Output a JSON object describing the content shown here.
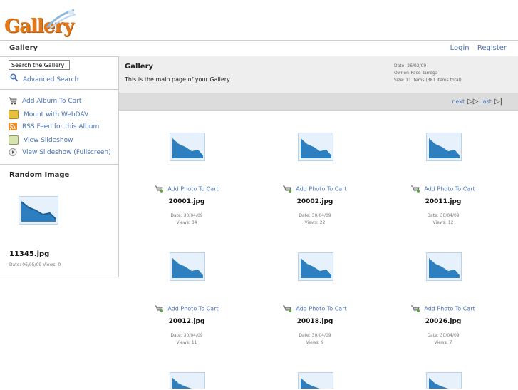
{
  "logo": {
    "text": "Gallery"
  },
  "topbar": {
    "title": "Gallery",
    "login": "Login",
    "register": "Register"
  },
  "sidebar": {
    "search_value": "Search the Gallery",
    "advanced_search": "Advanced Search",
    "items": [
      {
        "label": "Add Album To Cart",
        "icon": "cart-icon"
      },
      {
        "label": "Mount with WebDAV",
        "icon": "webdav-icon"
      },
      {
        "label": "RSS Feed for this Album",
        "icon": "rss-icon"
      },
      {
        "label": "View Slideshow",
        "icon": "slideshow-icon"
      },
      {
        "label": "View Slideshow (Fullscreen)",
        "icon": "slideshow-fullscreen-icon"
      }
    ],
    "random": {
      "title": "Random Image",
      "name": "11345.jpg",
      "meta": "Date: 06/05/09 Views: 0"
    }
  },
  "album": {
    "title": "Gallery",
    "description": "This is the main page of your Gallery",
    "date": "Date: 26/02/09",
    "owner": "Owner: Paco Tarrega",
    "size": "Size: 11 items (381 items total)"
  },
  "pager": {
    "next": "next",
    "last": "last"
  },
  "photos": [
    {
      "name": "20001.jpg",
      "cart": "Add Photo To Cart",
      "date": "Date: 30/04/09",
      "views": "Views: 34"
    },
    {
      "name": "20002.jpg",
      "cart": "Add Photo To Cart",
      "date": "Date: 30/04/09",
      "views": "Views: 22"
    },
    {
      "name": "20011.jpg",
      "cart": "Add Photo To Cart",
      "date": "Date: 30/04/09",
      "views": "Views: 12"
    },
    {
      "name": "20012.jpg",
      "cart": "Add Photo To Cart",
      "date": "Date: 30/04/09",
      "views": "Views: 11"
    },
    {
      "name": "20018.jpg",
      "cart": "Add Photo To Cart",
      "date": "Date: 30/04/09",
      "views": "Views: 9"
    },
    {
      "name": "20026.jpg",
      "cart": "Add Photo To Cart",
      "date": "Date: 30/04/09",
      "views": "Views: 7"
    }
  ],
  "colors": {
    "link": "#4a73b5",
    "logo": "#e0781c",
    "header_bg": "#eeeeee",
    "pager_bg": "#dcdcdc"
  }
}
